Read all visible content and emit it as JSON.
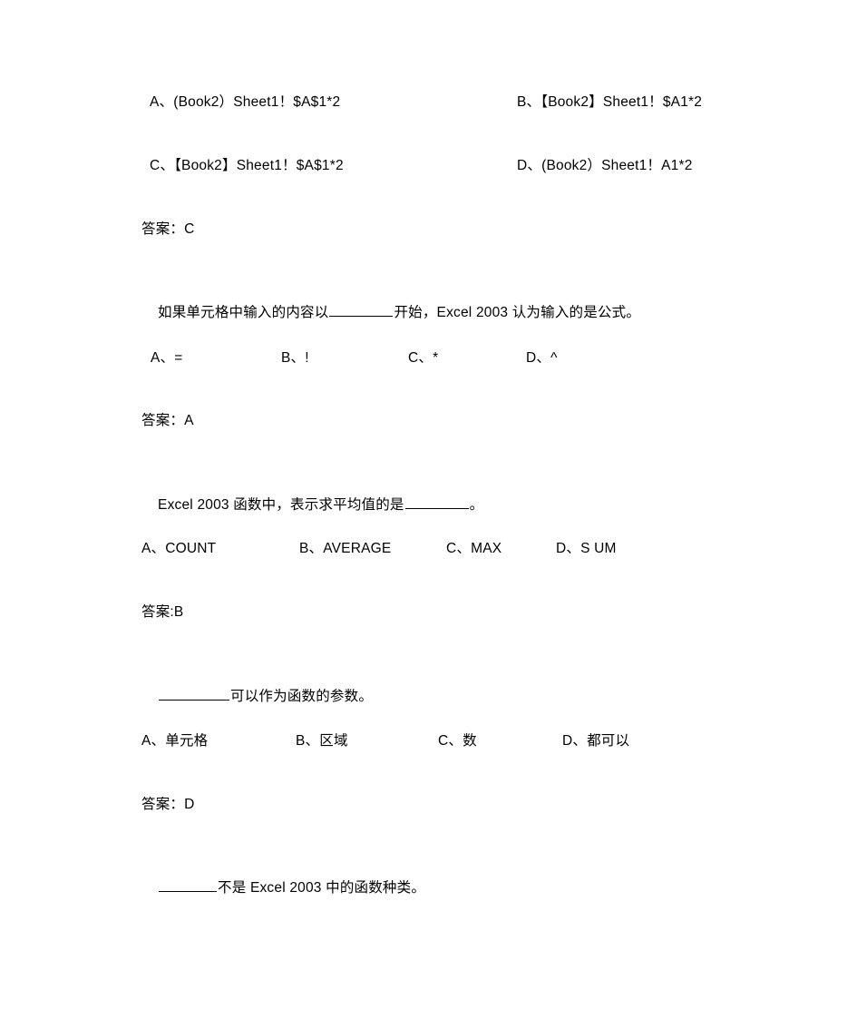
{
  "document": {
    "page_background": "#ffffff",
    "text_color": "#000000",
    "questions": [
      {
        "id": "q-cross-workbook-reference",
        "options_row_1": {
          "a": "A、(Book2）Sheet1！$A$1*2",
          "b": "B、【Book2】Sheet1！$A1*2"
        },
        "options_row_2": {
          "c": "C、【Book2】Sheet1！$A$1*2",
          "d": "D、(Book2）Sheet1！A1*2"
        },
        "answer": "答案：C"
      },
      {
        "id": "q-formula-prefix",
        "stem_before_blank": "如果单元格中输入的内容以",
        "stem_after_blank": "开始，Excel 2003 认为输入的是公式。",
        "options": {
          "a": "A、=",
          "b": "B、!",
          "c": "C、*",
          "d": "D、^"
        },
        "answer": "答案：A"
      },
      {
        "id": "q-average-function",
        "stem_before_blank": "Excel 2003 函数中，表示求平均值的是",
        "stem_after_blank": "。",
        "options": {
          "a": "A、COUNT",
          "b": "B、AVERAGE",
          "c": "C、MAX",
          "d": "D、S UM"
        },
        "answer": "答案:B"
      },
      {
        "id": "q-function-arguments",
        "stem_before_blank": "",
        "stem_after_blank": "可以作为函数的参数。",
        "options": {
          "a": "A、单元格",
          "b": "B、区域",
          "c": "C、数",
          "d": "D、都可以"
        },
        "answer": "答案：D"
      },
      {
        "id": "q-not-function-category",
        "stem_before_blank": "",
        "stem_after_blank": "不是 Excel 2003 中的函数种类。"
      }
    ]
  }
}
